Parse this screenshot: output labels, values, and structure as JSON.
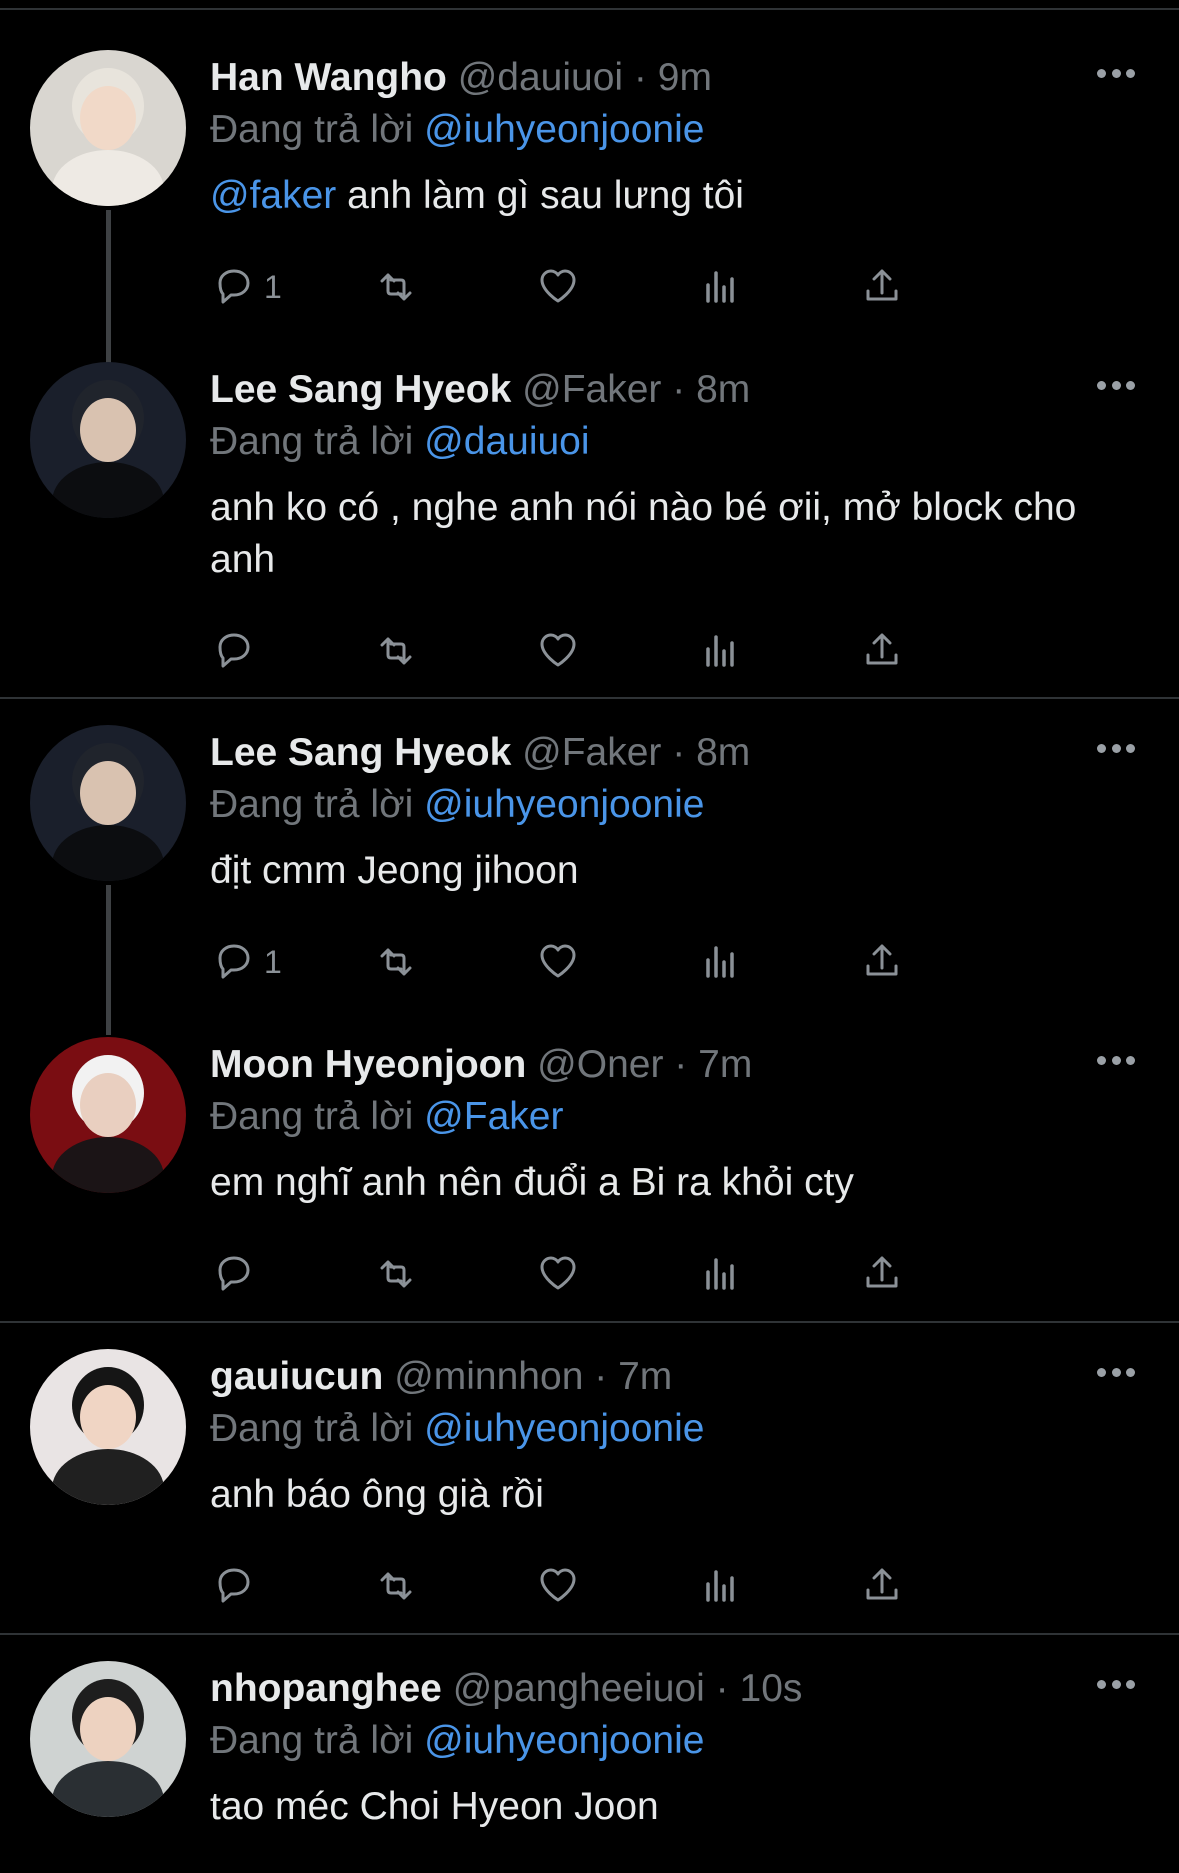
{
  "tweets": [
    {
      "name": "Han Wangho",
      "handle": "@dauiuoi",
      "dot": "·",
      "time": "9m",
      "reply_prefix": "Đang trả lời",
      "reply_to": "@iuhyeonjoonie",
      "text_mention": "@faker",
      "text": " anh làm gì sau lưng tôi",
      "reply_count": "1",
      "avatar_palette": {
        "bg": "#d9d6d0",
        "hair": "#e8e4dc",
        "face": "#f1d9c8",
        "body": "#eeeae4"
      }
    },
    {
      "name": "Lee Sang Hyeok",
      "handle": "@Faker",
      "dot": "·",
      "time": "8m",
      "reply_prefix": "Đang trả lời",
      "reply_to": "@dauiuoi",
      "text_mention": "",
      "text": "anh ko có , nghe anh nói nào bé ơii, mở block cho anh",
      "reply_count": "",
      "avatar_palette": {
        "bg": "#1a1f2b",
        "hair": "#20242c",
        "face": "#d9c2b0",
        "body": "#0c0d10"
      }
    },
    {
      "name": "Lee Sang Hyeok",
      "handle": "@Faker",
      "dot": "·",
      "time": "8m",
      "reply_prefix": "Đang trả lời",
      "reply_to": "@iuhyeonjoonie",
      "text_mention": "",
      "text": "địt cmm Jeong jihoon",
      "reply_count": "1",
      "avatar_palette": {
        "bg": "#1a1f2b",
        "hair": "#20242c",
        "face": "#d9c2b0",
        "body": "#0c0d10"
      }
    },
    {
      "name": "Moon Hyeonjoon",
      "handle": "@Oner",
      "dot": "·",
      "time": "7m",
      "reply_prefix": "Đang trả lời",
      "reply_to": "@Faker",
      "text_mention": "",
      "text": "em nghĩ anh nên đuổi a Bi ra khỏi cty",
      "reply_count": "",
      "avatar_palette": {
        "bg": "#7a0d12",
        "hair": "#f2f2f2",
        "face": "#e9cfc0",
        "body": "#1b1416"
      }
    },
    {
      "name": "gauiucun",
      "handle": "@minnhon",
      "dot": "·",
      "time": "7m",
      "reply_prefix": "Đang trả lời",
      "reply_to": "@iuhyeonjoonie",
      "text_mention": "",
      "text": "anh báo ông già rồi",
      "reply_count": "",
      "avatar_palette": {
        "bg": "#e9e4e4",
        "hair": "#151515",
        "face": "#f0d5c4",
        "body": "#202020"
      }
    },
    {
      "name": "nhopanghee",
      "handle": "@pangheeiuoi",
      "dot": "·",
      "time": "10s",
      "reply_prefix": "Đang trả lời",
      "reply_to": "@iuhyeonjoonie",
      "text_mention": "",
      "text": "tao méc Choi Hyeon Joon",
      "reply_count": "",
      "avatar_palette": {
        "bg": "#cfd3d2",
        "hair": "#1e1e1e",
        "face": "#edd2c0",
        "body": "#2a2f33"
      }
    }
  ],
  "icons": [
    "reply-icon",
    "retweet-icon",
    "like-icon",
    "views-icon",
    "share-icon",
    "more-icon"
  ],
  "colors": {
    "background": "#000000",
    "mention": "#4a95e8",
    "muted": "#71767b",
    "separator": "#2f3336"
  }
}
